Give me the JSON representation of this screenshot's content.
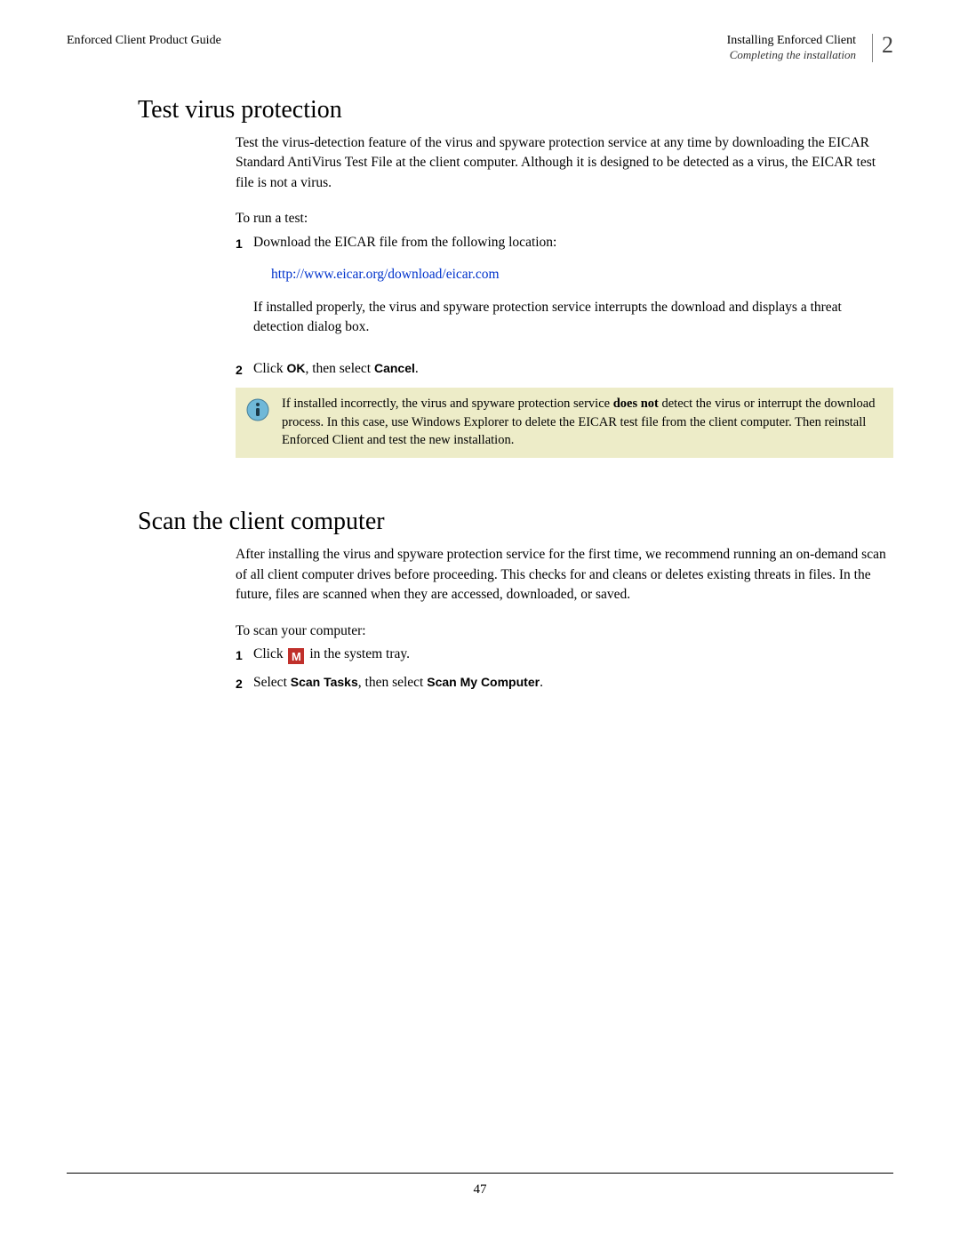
{
  "header": {
    "left": "Enforced Client Product Guide",
    "right_main": "Installing Enforced Client",
    "right_sub": "Completing the installation",
    "chapter": "2"
  },
  "sec1": {
    "title": "Test virus protection",
    "intro": "Test the virus-detection feature of the virus and spyware protection service at any time by downloading the EICAR Standard AntiVirus Test File at the client computer. Although it is designed to be detected as a virus, the EICAR test file is not a virus.",
    "leadin": "To run a test:",
    "step1_num": "1",
    "step1_text": "Download the EICAR file from the following location:",
    "link": "http://www.eicar.org/download/eicar.com",
    "step1_followup": "If installed properly, the virus and spyware protection service interrupts the download and displays a threat detection dialog box.",
    "step2_num": "2",
    "step2_a": "Click ",
    "step2_ok": "OK",
    "step2_b": ", then select ",
    "step2_cancel": "Cancel",
    "step2_c": ".",
    "note_a": "If installed incorrectly, the virus and spyware protection service ",
    "note_bold": "does not",
    "note_b": " detect the virus or interrupt the download process. In this case, use Windows Explorer to delete the EICAR test file from the client computer. Then reinstall Enforced Client and test the new installation."
  },
  "sec2": {
    "title": "Scan the client computer",
    "intro": "After installing the virus and spyware protection service for the first time, we recommend running an on-demand scan of all client computer drives before proceeding. This checks for and cleans or deletes existing threats in files. In the future, files are scanned when they are accessed, downloaded, or saved.",
    "leadin": "To scan your computer:",
    "step1_num": "1",
    "step1_a": "Click ",
    "step1_b": " in the system tray.",
    "tray_letter": "M",
    "step2_num": "2",
    "step2_a": "Select ",
    "step2_scantasks": "Scan Tasks",
    "step2_b": ", then select ",
    "step2_scanmy": "Scan My Computer",
    "step2_c": "."
  },
  "footer": {
    "page": "47"
  }
}
